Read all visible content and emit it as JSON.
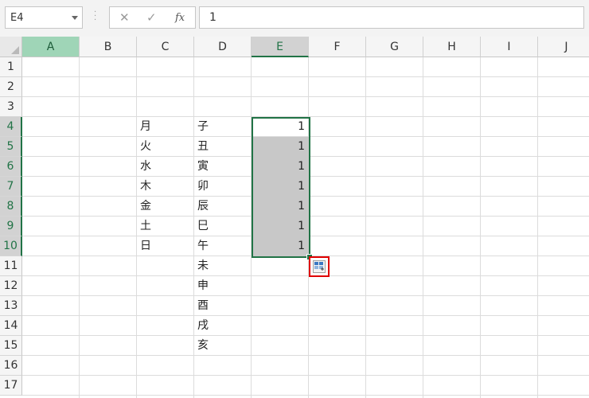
{
  "name_box": {
    "value": "E4"
  },
  "formula_bar": {
    "cancel_glyph": "✕",
    "enter_glyph": "✓",
    "fx_label": "fx",
    "value": "1"
  },
  "columns": [
    "A",
    "B",
    "C",
    "D",
    "E",
    "F",
    "G",
    "H",
    "I",
    "J"
  ],
  "rows": [
    "1",
    "2",
    "3",
    "4",
    "5",
    "6",
    "7",
    "8",
    "9",
    "10",
    "11",
    "12",
    "13",
    "14",
    "15",
    "16",
    "17"
  ],
  "selection": {
    "active_cell": "E4",
    "range": "E4:E10"
  },
  "cells": {
    "C": [
      "",
      "",
      "",
      "月",
      "火",
      "水",
      "木",
      "金",
      "土",
      "日",
      "",
      "",
      "",
      "",
      "",
      "",
      ""
    ],
    "D": [
      "",
      "",
      "",
      "子",
      "丑",
      "寅",
      "卯",
      "辰",
      "巳",
      "午",
      "未",
      "申",
      "酉",
      "戌",
      "亥",
      "",
      ""
    ],
    "E": [
      "",
      "",
      "",
      "1",
      "1",
      "1",
      "1",
      "1",
      "1",
      "1",
      "",
      "",
      "",
      "",
      "",
      "",
      ""
    ]
  },
  "autofill_options": {
    "icon": "autofill-options-icon",
    "highlight_color": "#e00000"
  },
  "colors": {
    "accent": "#217346",
    "selection_fill": "#c8c8c8"
  }
}
